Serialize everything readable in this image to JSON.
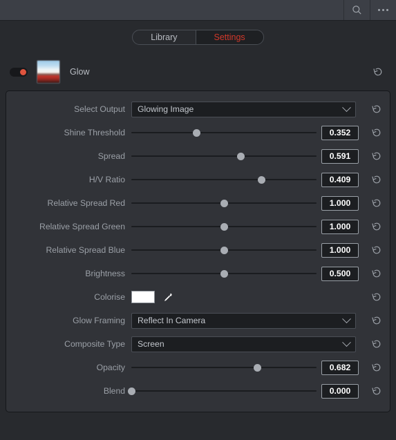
{
  "topbar": {
    "search_icon": "search-icon",
    "menu_icon": "more-options-icon"
  },
  "tabs": [
    {
      "label": "Library",
      "active": false
    },
    {
      "label": "Settings",
      "active": true
    }
  ],
  "effect": {
    "name": "Glow",
    "enabled": true,
    "toggle_color": "#e0543e",
    "reset_icon": "reset-icon"
  },
  "colors": {
    "accent": "#d2382a",
    "page_bg": "#282a2e",
    "panel_bg": "#313338",
    "topbar_bg": "#3c3f46",
    "label": "#9ba0a7",
    "value_text": "#ffffff",
    "knob": "#a9adb3",
    "swatch": "#ffffff"
  },
  "controls": [
    {
      "label": "Select Output",
      "type": "dropdown",
      "value": "Glowing Image",
      "reset": "reset-icon"
    },
    {
      "label": "Shine Threshold",
      "type": "slider",
      "value": "0.352",
      "pos": 35.2,
      "reset": "reset-icon"
    },
    {
      "label": "Spread",
      "type": "slider",
      "value": "0.591",
      "pos": 59.1,
      "reset": "reset-icon"
    },
    {
      "label": "H/V Ratio",
      "type": "slider",
      "value": "0.409",
      "pos": 70.5,
      "reset": "reset-icon"
    },
    {
      "label": "Relative Spread Red",
      "type": "slider",
      "value": "1.000",
      "pos": 50.0,
      "reset": "reset-icon"
    },
    {
      "label": "Relative Spread Green",
      "type": "slider",
      "value": "1.000",
      "pos": 50.0,
      "reset": "reset-icon"
    },
    {
      "label": "Relative Spread Blue",
      "type": "slider",
      "value": "1.000",
      "pos": 50.0,
      "reset": "reset-icon"
    },
    {
      "label": "Brightness",
      "type": "slider",
      "value": "0.500",
      "pos": 50.0,
      "reset": "reset-icon"
    },
    {
      "label": "Colorise",
      "type": "color",
      "value": "#ffffff",
      "picker_icon": "eyedropper-icon",
      "reset": "reset-icon"
    },
    {
      "label": "Glow Framing",
      "type": "dropdown",
      "value": "Reflect In Camera",
      "reset": "reset-icon"
    },
    {
      "label": "Composite Type",
      "type": "dropdown",
      "value": "Screen",
      "reset": "reset-icon"
    },
    {
      "label": "Opacity",
      "type": "slider",
      "value": "0.682",
      "pos": 68.2,
      "reset": "reset-icon"
    },
    {
      "label": "Blend",
      "type": "slider",
      "value": "0.000",
      "pos": 0.0,
      "reset": "reset-icon"
    }
  ]
}
